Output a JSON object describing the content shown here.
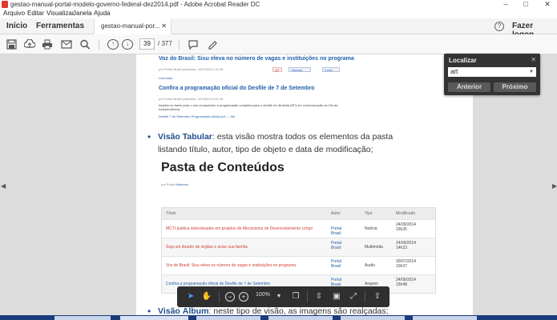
{
  "window": {
    "title": "gestao-manual-portal-modelo-governo-federal-dez2014.pdf - Adobe Acrobat Reader DC",
    "controls": [
      "–",
      "□",
      "✕"
    ]
  },
  "menu": [
    "Arquivo",
    "Editar",
    "Visualizar",
    "Janela",
    "Ajuda"
  ],
  "tabs": {
    "home": "Início",
    "tools": "Ferramentas",
    "document": "gestao-manual-por...",
    "close": "✕",
    "help": "?",
    "login": "Fazer logon"
  },
  "toolbar": {
    "page_current": "39",
    "page_total": "/ 377",
    "icons": [
      "save-icon",
      "upload-icon",
      "print-icon",
      "email-icon",
      "search-icon",
      "page-up-icon",
      "page-down-icon",
      "comment-icon",
      "pen-icon"
    ]
  },
  "page": {
    "feed1_title": "Voz do Brasil: Sisu eleva no número de vagas e instituições no programa",
    "feed1_meta": "por Portal Brasil publicado: 16/07/2014 10:48",
    "feed1_share1": "Tweetar",
    "feed1_share2": "Curtir",
    "feed1_more": "Leia mais",
    "feed2_title": "Confira a programação oficial do Desfile de 7 de Setembro",
    "feed2_meta": "por Portal Brasil publicado: 22/08/2014 09:28",
    "feed2_body": "Assista ou baixe para o seu computador a programação completa para o desfile em Brasília (DF) em comemoração ao Dia da Independência",
    "feed2_links": "Desfile 7 de Setembro   Programação oficial.pdf — 1kb",
    "bullet1_label": "Visão Tabular",
    "bullet1_text": ": esta visão mostra todos os elementos da pasta listando título, autor, tipo de objeto e data de modificação;",
    "heading": "Pasta de Conteúdos",
    "byline": "por Portal",
    "byline_link": "Histórico",
    "table_headers": [
      "Título",
      "Autor",
      "Tipo",
      "Modificado"
    ],
    "rows": [
      {
        "title": "MCTI publica selecionados em projetos de Mecanismo de Desenvolvimento Limpo",
        "author": "Portal Brasil",
        "type": "Notícia",
        "mod": "24/09/2014 16h35"
      },
      {
        "title": "Seja um doador de órgãos e avise sua família",
        "author": "Portal Brasil",
        "type": "Multimídia",
        "mod": "24/09/2014 14h23"
      },
      {
        "title": "Voz do Brasil: Sisu eleva no número de vagas e instituições no programa",
        "author": "Portal Brasil",
        "type": "Áudio",
        "mod": "30/07/2014 10h37"
      },
      {
        "title": "Confira a programação oficial do Desfile de 7 de Setembro",
        "author": "Portal Brasil",
        "type": "Arquivo",
        "mod": "24/09/2014 15h48"
      }
    ],
    "bullet2_label": "Visão Álbum",
    "bullet2_text": ": neste tipo de visão, as imagens são realçadas;"
  },
  "find": {
    "title": "Localizar",
    "close": "✕",
    "query": "art",
    "prev": "Anterior",
    "next": "Próximo"
  },
  "floatbar": {
    "zoom": "100%"
  }
}
